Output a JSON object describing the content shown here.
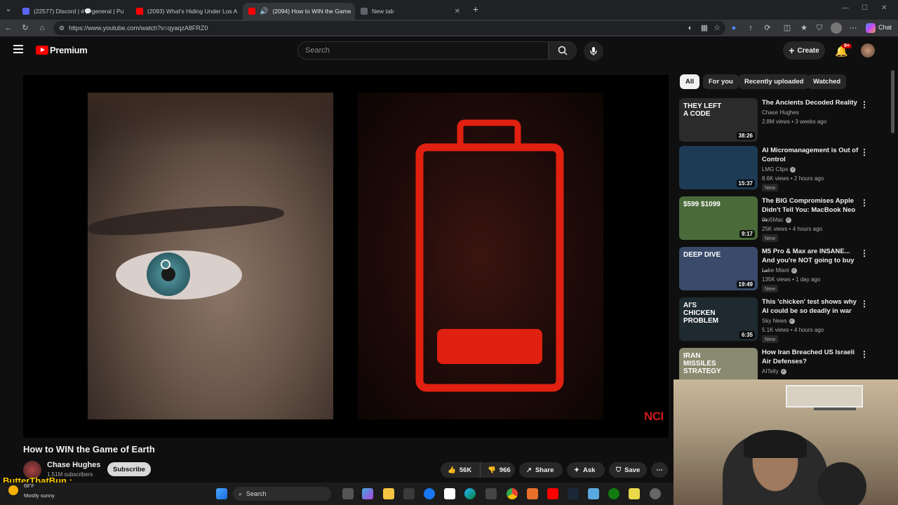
{
  "browser": {
    "tabs": [
      {
        "title": "(22577) Discord | #💬general | Pu",
        "color": "#5865f2"
      },
      {
        "title": "(2093) What's Hiding Under Los A",
        "color": "#ff0000"
      },
      {
        "title": "(2094) How to WIN the Game",
        "color": "#ff0000"
      },
      {
        "title": "New tab",
        "color": "#5f6368"
      }
    ],
    "url": "https://www.youtube.com/watch?v=qyaqzA8FRZ0",
    "chat_label": "Chat"
  },
  "header": {
    "logo_text": "Premium",
    "search_placeholder": "Search",
    "create_label": "Create",
    "notif_count": "9+"
  },
  "video": {
    "title": "How to WIN the Game of Earth",
    "channel": "Chase Hughes",
    "subscribers": "1.51M subscribers",
    "subscribe_label": "Subscribe",
    "likes": "56K",
    "dislikes": "966",
    "share_label": "Share",
    "ask_label": "Ask",
    "save_label": "Save",
    "watermark": "NCI"
  },
  "chips": [
    "All",
    "For you",
    "Recently uploaded",
    "Watched"
  ],
  "recommendations": [
    {
      "title": "The Ancients Decoded Reality",
      "channel": "Chase Hughes",
      "meta": "2.8M views • 3 weeks ago",
      "duration": "38:26",
      "verified": false,
      "new": false,
      "thumb_text": "THEY LEFT A CODE",
      "bg": "#2b2b2b"
    },
    {
      "title": "AI Micromanagement is Out of Control",
      "channel": "LMG Clips",
      "meta": "8.6K views • 2 hours ago",
      "duration": "15:37",
      "verified": true,
      "new": true,
      "thumb_text": "",
      "bg": "#1d3b55"
    },
    {
      "title": "The BIG Compromises Apple Didn't Tell You: MacBook Neo ...",
      "channel": "9to5Mac",
      "meta": "25K views • 4 hours ago",
      "duration": "9:17",
      "verified": true,
      "new": true,
      "thumb_text": "$599 $1099",
      "bg": "#4a6a3a"
    },
    {
      "title": "M5 Pro & Max are INSANE... And you're NOT going to buy ...",
      "channel": "Luke Miani",
      "meta": "135K views • 1 day ago",
      "duration": "19:49",
      "verified": true,
      "new": true,
      "thumb_text": "DEEP DIVE",
      "bg": "#3a4a6a"
    },
    {
      "title": "This 'chicken' test shows why AI could be so deadly in war",
      "channel": "Sky News",
      "meta": "5.1K views • 4 hours ago",
      "duration": "6:35",
      "verified": true,
      "new": true,
      "thumb_text": "AI'S CHICKEN PROBLEM",
      "bg": "#1e2a30"
    },
    {
      "title": "How Iran Breached US Israeli Air Defenses?",
      "channel": "AITelly",
      "meta": "",
      "duration": "",
      "verified": true,
      "new": false,
      "thumb_text": "IRAN MISSILES STRATEGY",
      "bg": "#8a8a70"
    }
  ],
  "stream_overlay": {
    "name": "ButterThatBun :",
    "weather_temp": "68°F",
    "weather_desc": "Mostly sunny"
  },
  "taskbar": {
    "search_label": "Search"
  }
}
